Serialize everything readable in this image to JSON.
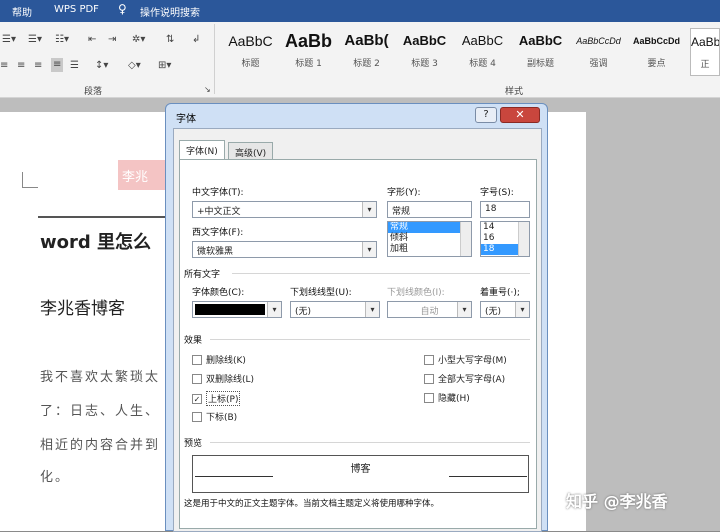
{
  "menubar": {
    "items": [
      "帮助",
      "WPS PDF",
      "操作说明搜索"
    ]
  },
  "ribbon": {
    "group_paragraph": "段落",
    "group_styles": "样式",
    "styles": [
      {
        "sample": "AaBbC",
        "name": "标题"
      },
      {
        "sample": "AaBb",
        "name": "标题 1"
      },
      {
        "sample": "AaBb(",
        "name": "标题 2"
      },
      {
        "sample": "AaBbC",
        "name": "标题 3"
      },
      {
        "sample": "AaBbC",
        "name": "标题 4"
      },
      {
        "sample": "AaBbC",
        "name": "副标题"
      },
      {
        "sample": "AaBbCcDd",
        "name": "强调"
      },
      {
        "sample": "AaBbCcDd",
        "name": "要点"
      },
      {
        "sample": "AaBb",
        "name": "正"
      }
    ]
  },
  "document": {
    "stamp": "李兆",
    "heading": "word 里怎么",
    "subheading": "李兆香博客",
    "para": [
      "我不喜欢太繁琐太",
      "了：日志、人生、",
      "相近的内容合并到",
      "化。"
    ]
  },
  "watermark": {
    "site": "知乎",
    "author": "@李兆香"
  },
  "dialog": {
    "title": "字体",
    "help": "?",
    "close": "✕",
    "tabs": [
      "字体(N)",
      "高级(V)"
    ],
    "cn_font_label": "中文字体(T):",
    "cn_font_value": "+中文正文",
    "en_font_label": "西文字体(F):",
    "en_font_value": "微软雅黑",
    "style_label": "字形(Y):",
    "style_value": "常规",
    "style_list": [
      "常规",
      "倾斜",
      "加粗"
    ],
    "size_label": "字号(S):",
    "size_value": "18",
    "size_list": [
      "14",
      "16",
      "18"
    ],
    "all_text": "所有文字",
    "font_color_label": "字体颜色(C):",
    "underline_label": "下划线线型(U):",
    "underline_value": "(无)",
    "underline_color_label": "下划线颜色(I):",
    "underline_color_value": "自动",
    "emphasis_label": "着重号(·);",
    "emphasis_value": "(无)",
    "effects": "效果",
    "effects_left": [
      {
        "label": "删除线(K)",
        "checked": false
      },
      {
        "label": "双删除线(L)",
        "checked": false
      },
      {
        "label": "上标(P)",
        "checked": true
      },
      {
        "label": "下标(B)",
        "checked": false
      }
    ],
    "effects_right": [
      {
        "label": "小型大写字母(M)",
        "checked": false
      },
      {
        "label": "全部大写字母(A)",
        "checked": false
      },
      {
        "label": "隐藏(H)",
        "checked": false
      }
    ],
    "preview_label": "预览",
    "preview_text": "博客",
    "footer": "这是用于中文的正文主题字体。当前文档主题定义将使用哪种字体。",
    "checkmark": "✓",
    "arrow": "▾"
  }
}
